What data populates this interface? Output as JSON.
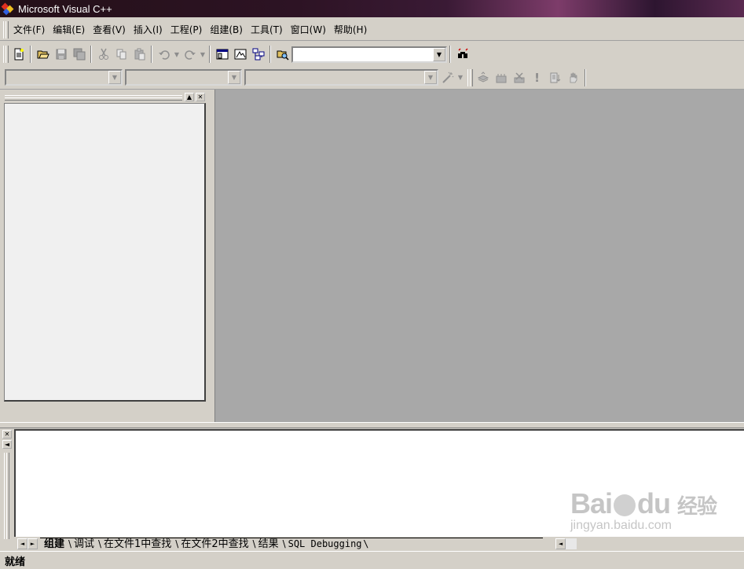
{
  "window": {
    "title": "Microsoft Visual C++"
  },
  "menu": {
    "items": [
      "文件(F)",
      "编辑(E)",
      "查看(V)",
      "插入(I)",
      "工程(P)",
      "组建(B)",
      "工具(T)",
      "窗口(W)",
      "帮助(H)"
    ]
  },
  "toolbar1": {
    "buttons": [
      "new-icon",
      "open-icon",
      "save-icon",
      "save-all-icon",
      "cut-icon",
      "copy-icon",
      "paste-icon",
      "undo-icon",
      "redo-icon",
      "workspace-icon",
      "output-icon",
      "window-list-icon",
      "find-in-files-icon",
      "find-icon"
    ],
    "find_value": ""
  },
  "toolbar2": {
    "class_combo": "",
    "filter_combo": "",
    "members_combo": "",
    "buttons": [
      "wizard-icon",
      "compile-icon",
      "build-icon",
      "stop-build-icon",
      "execute-icon",
      "go-icon",
      "breakpoint-icon"
    ]
  },
  "output": {
    "tabs": [
      "组建",
      "调试",
      "在文件1中查找",
      "在文件2中查找",
      "结果",
      "SQL Debugging"
    ],
    "active_tab": "组建"
  },
  "status": {
    "text": "就绪"
  },
  "watermark": {
    "logo_left": "Bai",
    "logo_right": "du",
    "logo_cn": "经验",
    "url": "jingyan.baidu.com"
  }
}
